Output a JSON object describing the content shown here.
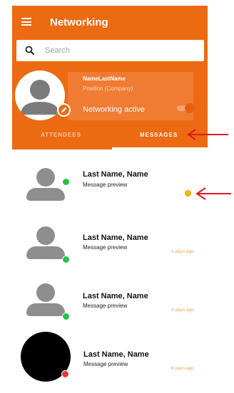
{
  "app": {
    "title": "Networking"
  },
  "search": {
    "placeholder": "Search",
    "value": ""
  },
  "profile": {
    "name": "NameLastName",
    "position": "Position (Company)",
    "networking_label": "Networking active",
    "networking_active": true
  },
  "tabs": [
    {
      "label": "ATTENDEES",
      "selected": false
    },
    {
      "label": "MESSAGES",
      "selected": true
    }
  ],
  "messages": [
    {
      "name": "Last Name, Name",
      "preview": "Message preview",
      "time": "",
      "unread": true,
      "status": "online",
      "avatar": "placeholder-person"
    },
    {
      "name": "Last Name, Name",
      "preview": "Message preview",
      "time": "3 days ago",
      "unread": false,
      "status": "online",
      "avatar": "placeholder-person"
    },
    {
      "name": "Last Name, Name",
      "preview": "Message preview",
      "time": "3 days ago",
      "unread": false,
      "status": "online",
      "avatar": "placeholder-person"
    },
    {
      "name": "Last Name, Name",
      "preview": "Message preview",
      "time": "9 days ago",
      "unread": false,
      "status": "offline",
      "avatar": "black-circle"
    }
  ],
  "colors": {
    "brand": "#ec6a12",
    "online": "#22c548",
    "offline": "#e53935",
    "unread": "#f5b800",
    "annotation_arrow": "#e0191e"
  },
  "icons": [
    "menu-icon",
    "search-icon",
    "edit-pencil-icon",
    "annotation-arrow-icon"
  ]
}
